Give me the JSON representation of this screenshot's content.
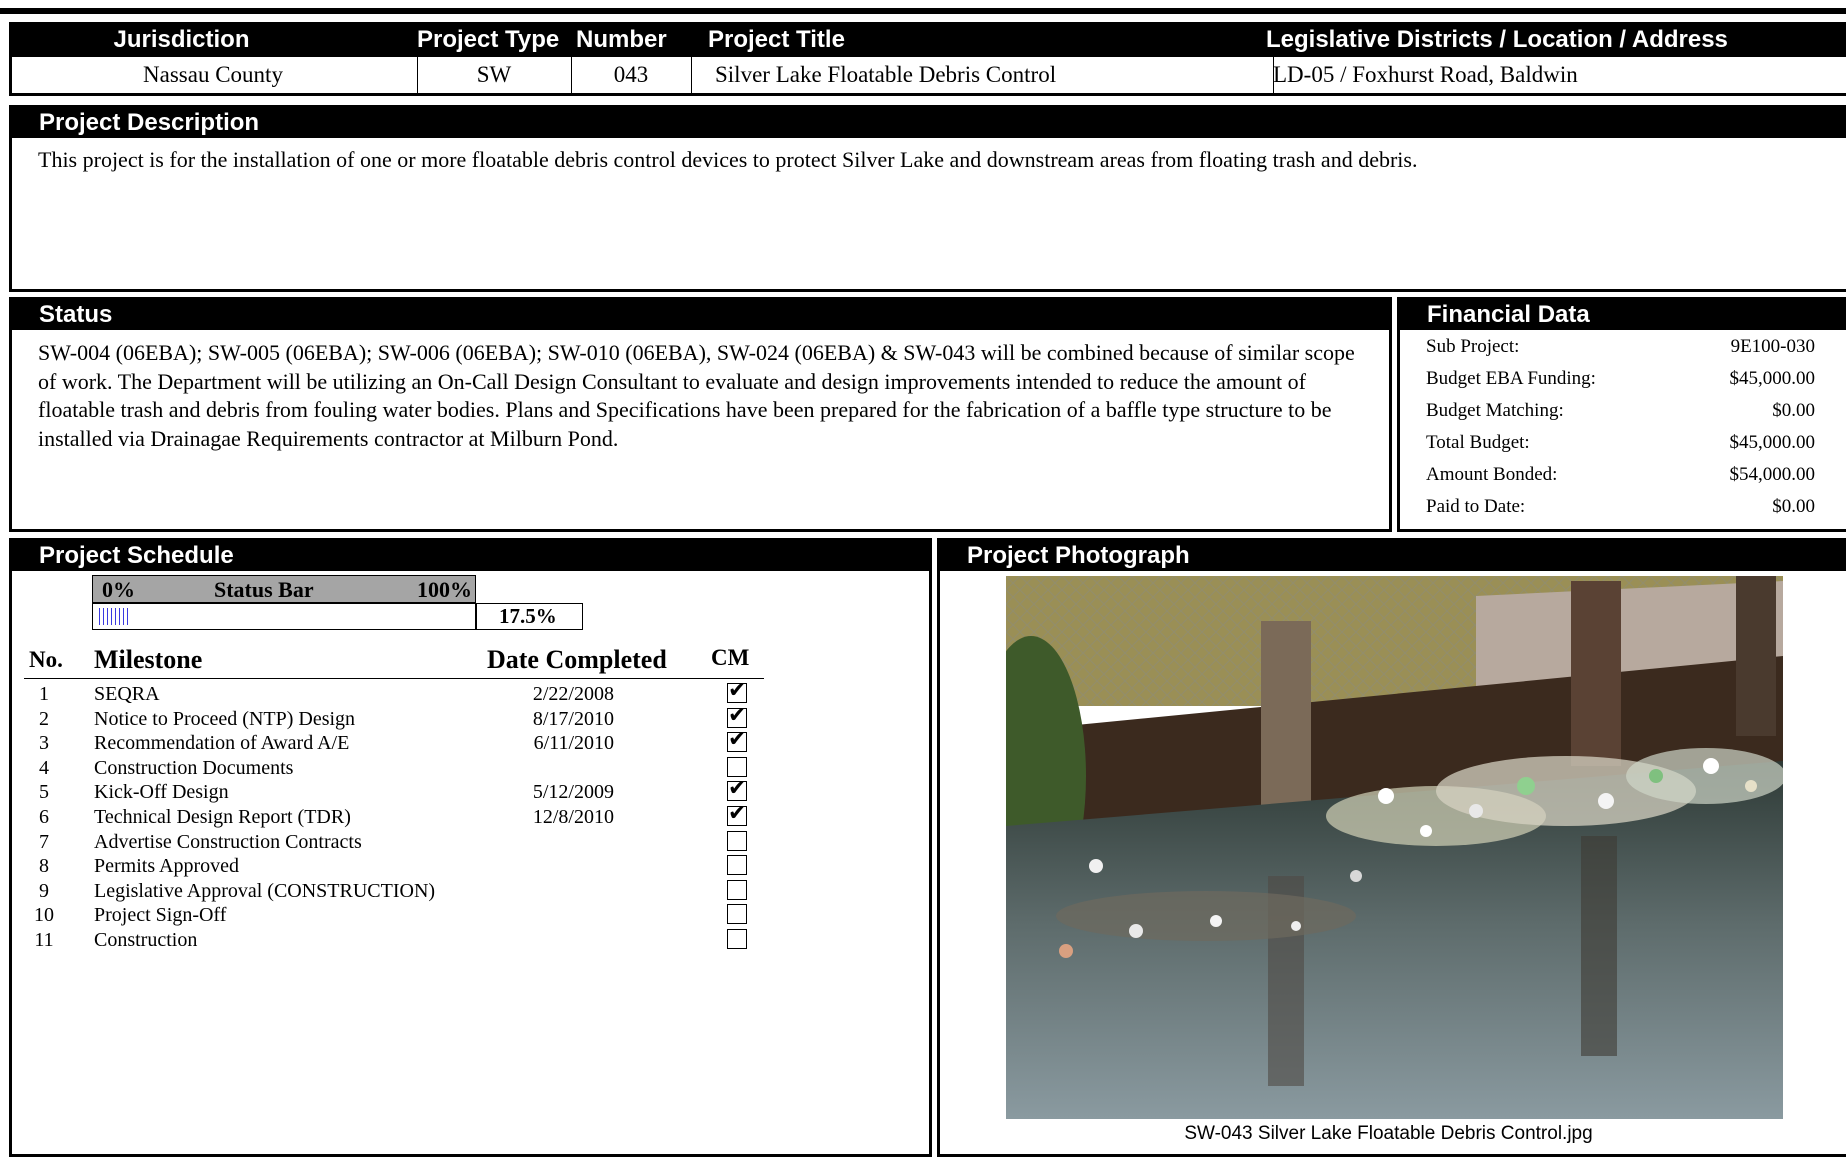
{
  "header": {
    "columns": [
      "Jurisdiction",
      "Project Type",
      "Number",
      "Project Title",
      "Legislative Districts / Location / Address"
    ],
    "values": {
      "jurisdiction": "Nassau County",
      "project_type": "SW",
      "number": "043",
      "project_title": "Silver Lake Floatable Debris Control",
      "location": "LD-05 / Foxhurst Road, Baldwin"
    }
  },
  "description": {
    "title": "Project Description",
    "text": "This project is for the installation of one or more floatable debris control devices to protect Silver Lake and downstream areas from floating trash and debris."
  },
  "status": {
    "title": "Status",
    "text": "SW-004 (06EBA); SW-005 (06EBA); SW-006 (06EBA); SW-010 (06EBA), SW-024 (06EBA) & SW-043 will be combined because of similar scope of work. The Department will be utilizing an On-Call Design Consultant to evaluate and design improvements intended to reduce the amount of floatable trash and debris from fouling water bodies.  Plans and Specifications have been prepared for the fabrication of a baffle type structure to be installed via Drainagae Requirements contractor at Milburn Pond."
  },
  "financial": {
    "title": "Financial Data",
    "rows": [
      {
        "label": "Sub Project:",
        "value": "9E100-030"
      },
      {
        "label": "Budget EBA Funding:",
        "value": "$45,000.00"
      },
      {
        "label": "Budget Matching:",
        "value": "$0.00"
      },
      {
        "label": "Total Budget:",
        "value": "$45,000.00"
      },
      {
        "label": "Amount Bonded:",
        "value": "$54,000.00"
      },
      {
        "label": "Paid to Date:",
        "value": "$0.00"
      }
    ]
  },
  "schedule": {
    "title": "Project Schedule",
    "status_bar": {
      "min_label": "0%",
      "label": "Status Bar",
      "max_label": "100%",
      "percent_text": "17.5%",
      "progress": 0.175
    },
    "headers": {
      "no": "No.",
      "milestone": "Milestone",
      "date": "Date Completed",
      "cm": "CM"
    },
    "milestones": [
      {
        "no": "1",
        "name": "SEQRA",
        "date": "2/22/2008",
        "cm": true
      },
      {
        "no": "2",
        "name": "Notice to Proceed (NTP) Design",
        "date": "8/17/2010",
        "cm": true
      },
      {
        "no": "3",
        "name": "Recommendation of Award A/E",
        "date": "6/11/2010",
        "cm": true
      },
      {
        "no": "4",
        "name": "Construction Documents",
        "date": "",
        "cm": false
      },
      {
        "no": "5",
        "name": "Kick-Off Design",
        "date": "5/12/2009",
        "cm": true
      },
      {
        "no": "6",
        "name": "Technical Design Report (TDR)",
        "date": "12/8/2010",
        "cm": true
      },
      {
        "no": "7",
        "name": "Advertise Construction Contracts",
        "date": "",
        "cm": false
      },
      {
        "no": "8",
        "name": "Permits Approved",
        "date": "",
        "cm": false
      },
      {
        "no": "9",
        "name": "Legislative Approval (CONSTRUCTION)",
        "date": "",
        "cm": false
      },
      {
        "no": "10",
        "name": "Project Sign-Off",
        "date": "",
        "cm": false
      },
      {
        "no": "11",
        "name": "Construction",
        "date": "",
        "cm": false
      }
    ]
  },
  "photo": {
    "title": "Project Photograph",
    "caption": "SW-043 Silver Lake Floatable Debris Control.jpg"
  }
}
